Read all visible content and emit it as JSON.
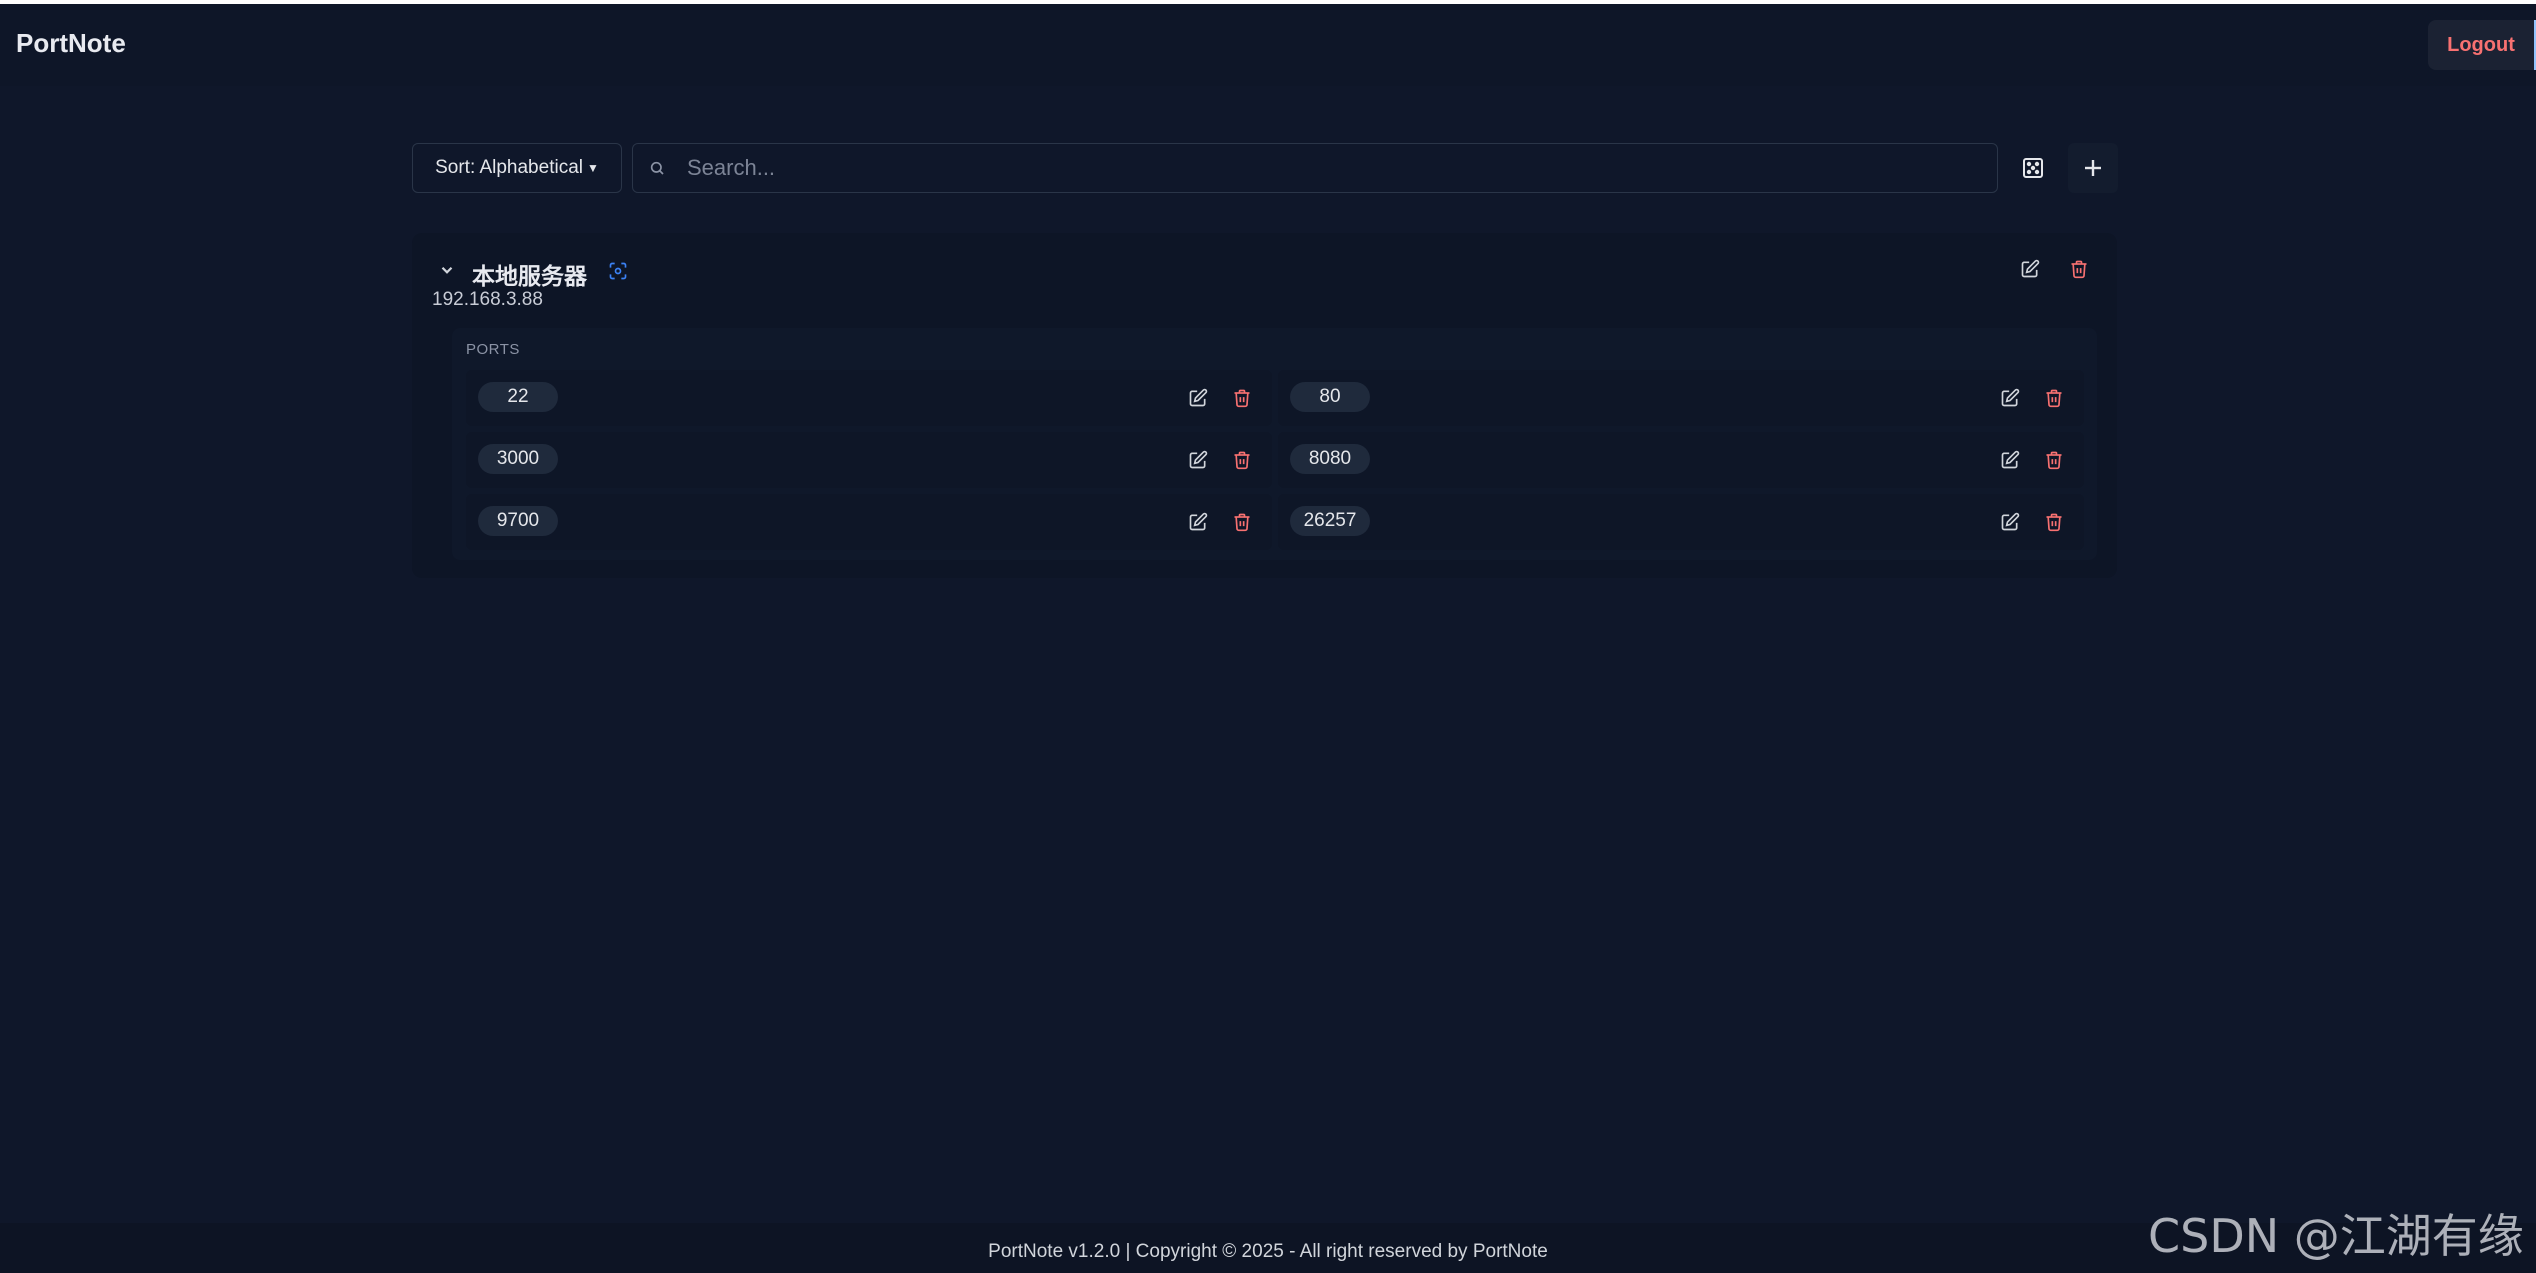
{
  "app": {
    "title": "PortNote"
  },
  "header": {
    "logout_label": "Logout"
  },
  "toolbar": {
    "sort_label": "Sort: Alphabetical",
    "search_placeholder": "Search...",
    "search_value": "",
    "random_icon": "dice-icon",
    "add_icon": "plus-icon"
  },
  "server": {
    "name": "本地服务器",
    "ip": "192.168.3.88",
    "ports_label": "PORTS",
    "ports": [
      "22",
      "80",
      "3000",
      "8080",
      "9700",
      "26257"
    ]
  },
  "footer": {
    "text": "PortNote v1.2.0 | Copyright © 2025 - All right reserved by PortNote"
  },
  "watermark": {
    "text": "CSDN @江湖有缘"
  },
  "colors": {
    "background": "#0f172a",
    "danger": "#f87171",
    "accent": "#3b82f6"
  }
}
